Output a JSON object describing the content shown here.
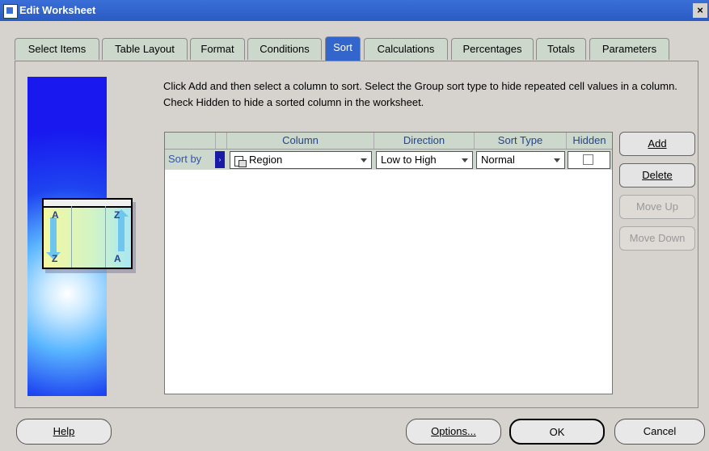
{
  "window": {
    "title": "Edit Worksheet",
    "close_glyph": "×"
  },
  "tabs": [
    {
      "label": "Select Items"
    },
    {
      "label": "Table Layout"
    },
    {
      "label": "Format"
    },
    {
      "label": "Conditions"
    },
    {
      "label": "Sort",
      "active": true
    },
    {
      "label": "Calculations"
    },
    {
      "label": "Percentages"
    },
    {
      "label": "Totals"
    },
    {
      "label": "Parameters"
    }
  ],
  "illustration": {
    "letters": [
      "A",
      "Z",
      "Z",
      "A"
    ]
  },
  "instructions": "Click Add and then select a column to sort. Select the Group sort type to hide repeated cell values in a column. Check Hidden to hide a sorted column in the worksheet.",
  "grid": {
    "headers": [
      "Column",
      "Direction",
      "Sort Type",
      "Hidden"
    ],
    "rows": [
      {
        "label": "Sort by",
        "selector_glyph": "›",
        "column": "Region",
        "direction": "Low to High",
        "sort_type": "Normal",
        "hidden": false
      }
    ]
  },
  "side_buttons": [
    {
      "label": "Add",
      "enabled": true
    },
    {
      "label": "Delete",
      "enabled": true
    },
    {
      "label": "Move Up",
      "enabled": false
    },
    {
      "label": "Move Down",
      "enabled": false
    }
  ],
  "footer": {
    "help": "Help",
    "options": "Options...",
    "ok": "OK",
    "cancel": "Cancel"
  }
}
